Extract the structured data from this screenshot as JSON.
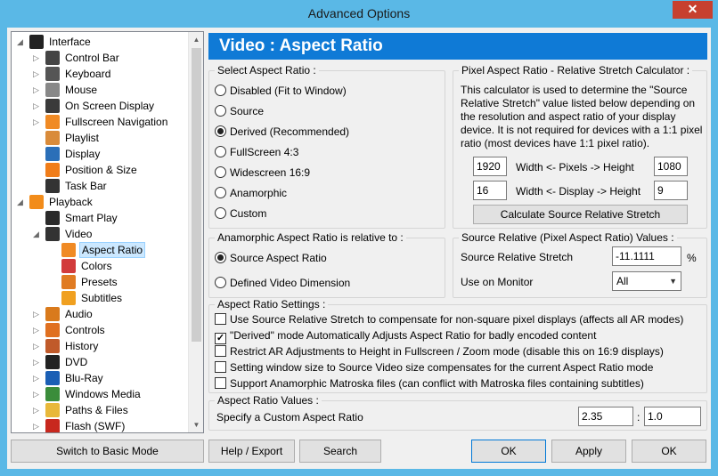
{
  "window": {
    "title": "Advanced Options",
    "close_glyph": "✕"
  },
  "tree": {
    "items": [
      {
        "label": "Interface",
        "icon": "monitor-icon",
        "color": "#222222"
      },
      {
        "label": "Control Bar",
        "icon": "control-bar-icon",
        "color": "#444444"
      },
      {
        "label": "Keyboard",
        "icon": "keyboard-icon",
        "color": "#555555"
      },
      {
        "label": "Mouse",
        "icon": "mouse-icon",
        "color": "#888888"
      },
      {
        "label": "On Screen Display",
        "icon": "osd-icon",
        "color": "#3a3a3a"
      },
      {
        "label": "Fullscreen Navigation",
        "icon": "fullscreen-nav-icon",
        "color": "#f08a24"
      },
      {
        "label": "Playlist",
        "icon": "playlist-icon",
        "color": "#d98b3a"
      },
      {
        "label": "Display",
        "icon": "display-icon",
        "color": "#2b6fb8"
      },
      {
        "label": "Position & Size",
        "icon": "position-icon",
        "color": "#f07d1a"
      },
      {
        "label": "Task Bar",
        "icon": "taskbar-icon",
        "color": "#333333"
      },
      {
        "label": "Playback",
        "icon": "play-icon",
        "color": "#f28c1a"
      },
      {
        "label": "Smart Play",
        "icon": "smart-play-icon",
        "color": "#2a2a2a"
      },
      {
        "label": "Video",
        "icon": "video-icon",
        "color": "#333333"
      },
      {
        "label": "Aspect Ratio",
        "icon": "aspect-ratio-icon",
        "color": "#f08a24"
      },
      {
        "label": "Colors",
        "icon": "colors-icon",
        "color": "#d23b3b"
      },
      {
        "label": "Presets",
        "icon": "presets-icon",
        "color": "#e07b22"
      },
      {
        "label": "Subtitles",
        "icon": "subtitles-icon",
        "color": "#f0a020"
      },
      {
        "label": "Audio",
        "icon": "audio-icon",
        "color": "#d97a1c"
      },
      {
        "label": "Controls",
        "icon": "controls-icon",
        "color": "#e07020"
      },
      {
        "label": "History",
        "icon": "history-icon",
        "color": "#c05a2a"
      },
      {
        "label": "DVD",
        "icon": "dvd-icon",
        "color": "#222222"
      },
      {
        "label": "Blu-Ray",
        "icon": "bluray-icon",
        "color": "#1b5fb5"
      },
      {
        "label": "Windows Media",
        "icon": "windows-icon",
        "color": "#3b8d3b"
      },
      {
        "label": "Paths & Files",
        "icon": "folder-icon",
        "color": "#e8b83a"
      },
      {
        "label": "Flash (SWF)",
        "icon": "flash-icon",
        "color": "#c8281e"
      }
    ],
    "selected_index": 13
  },
  "header": {
    "title": "Video : Aspect Ratio"
  },
  "select_ar": {
    "legend": "Select Aspect Ratio :",
    "options": [
      "Disabled (Fit to Window)",
      "Source",
      "Derived (Recommended)",
      "FullScreen 4:3",
      "Widescreen 16:9",
      "Anamorphic",
      "Custom"
    ],
    "selected": 2
  },
  "par_calc": {
    "legend": "Pixel Aspect Ratio - Relative Stretch Calculator :",
    "description": "This calculator is used to determine the \"Source Relative Stretch\" value listed below depending on the resolution and aspect ratio of your display device.  It is not required for devices with a 1:1 pixel ratio (most devices have 1:1 pixel ratio).",
    "pixels_width": "1920",
    "pixels_height": "1080",
    "pixels_label": "Width <-  Pixels ->  Height",
    "display_width": "16",
    "display_height": "9",
    "display_label": "Width <- Display -> Height",
    "calc_button": "Calculate Source Relative Stretch"
  },
  "anamorphic": {
    "legend": "Anamorphic Aspect Ratio is relative to :",
    "options": [
      "Source Aspect Ratio",
      "Defined Video Dimension"
    ],
    "selected": 0
  },
  "source_relative": {
    "legend": "Source Relative (Pixel Aspect Ratio) Values :",
    "stretch_label": "Source Relative Stretch",
    "stretch_value": "-11.1111",
    "stretch_unit": "%",
    "monitor_label": "Use on Monitor",
    "monitor_value": "All"
  },
  "ar_settings": {
    "legend": "Aspect Ratio Settings :",
    "items": [
      {
        "label": "Use Source Relative Stretch to compensate for non-square pixel displays (affects all AR modes)",
        "checked": false
      },
      {
        "label": "\"Derived\" mode Automatically Adjusts Aspect Ratio for badly encoded content",
        "checked": true
      },
      {
        "label": "Restrict AR Adjustments to Height in Fullscreen / Zoom mode (disable this on 16:9 displays)",
        "checked": false
      },
      {
        "label": "Setting window size to Source Video size compensates for the current Aspect Ratio mode",
        "checked": false
      },
      {
        "label": "Support Anamorphic Matroska files (can conflict with Matroska files containing subtitles)",
        "checked": false
      }
    ]
  },
  "ar_values": {
    "legend": "Aspect Ratio Values :",
    "label": "Specify a Custom Aspect Ratio",
    "value1": "2.35",
    "separator": ":",
    "value2": "1.0"
  },
  "buttons": {
    "basic_mode": "Switch to Basic Mode",
    "help_export": "Help / Export",
    "search": "Search",
    "ok": "OK",
    "apply": "Apply",
    "ok_confirm": "OK"
  }
}
